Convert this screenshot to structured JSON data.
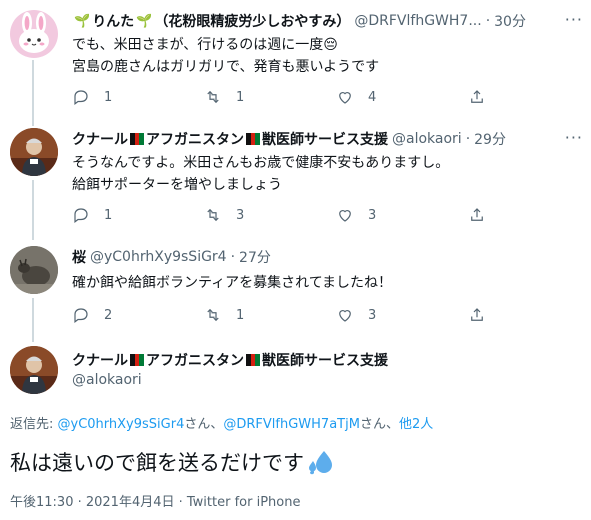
{
  "tweets": [
    {
      "name_left_emoji": "sprout",
      "name": "りんた",
      "name_suffix": "（花粉眼精疲労少しおやすみ）",
      "handle": "@DRFVlfhGWH7...",
      "dot": "·",
      "time": "30分",
      "lines": [
        "でも、米田さまが、行けるのは週に一度😔",
        "宮島の鹿さんはガリガリで、発育も悪いようです"
      ],
      "reply_count": "1",
      "retweet_count": "1",
      "like_count": "4"
    },
    {
      "name_prefix": "クナール",
      "name_mid": "アフガニスタン",
      "name_suffix": "獣医師サービス支援",
      "handle": "@alokaori",
      "dot": "·",
      "time": "29分",
      "lines": [
        "そうなんですよ。米田さんもお歳で健康不安もありますし。",
        "給餌サポーターを増やしましょう"
      ],
      "reply_count": "1",
      "retweet_count": "3",
      "like_count": "3"
    },
    {
      "name": "桜",
      "handle": "@yC0hrhXy9sSiGr4",
      "dot": "·",
      "time": "27分",
      "lines": [
        "確か餌や給餌ボランティアを募集されてましたね！"
      ],
      "reply_count": "2",
      "retweet_count": "1",
      "like_count": "3"
    }
  ],
  "main": {
    "name_prefix": "クナール",
    "name_mid": "アフガニスタン",
    "name_suffix": "獣医師サービス支援",
    "handle": "@alokaori",
    "replying_label": "返信先: ",
    "reply_to_1": "@yC0hrhXy9sSiGr4",
    "sep_1": "さん、",
    "reply_to_2": "@DRFVlfhGWH7aTjM",
    "sep_2": "さん、",
    "others": "他2人",
    "text": "私は遠いので餌を送るだけです",
    "emoji": "sweat-droplets",
    "meta": "午後11:30 · 2021年4月4日 · Twitter for iPhone"
  },
  "colors": {
    "link": "#1d9bf0",
    "secondary": "#536471",
    "thread_line": "#cfd9de"
  }
}
